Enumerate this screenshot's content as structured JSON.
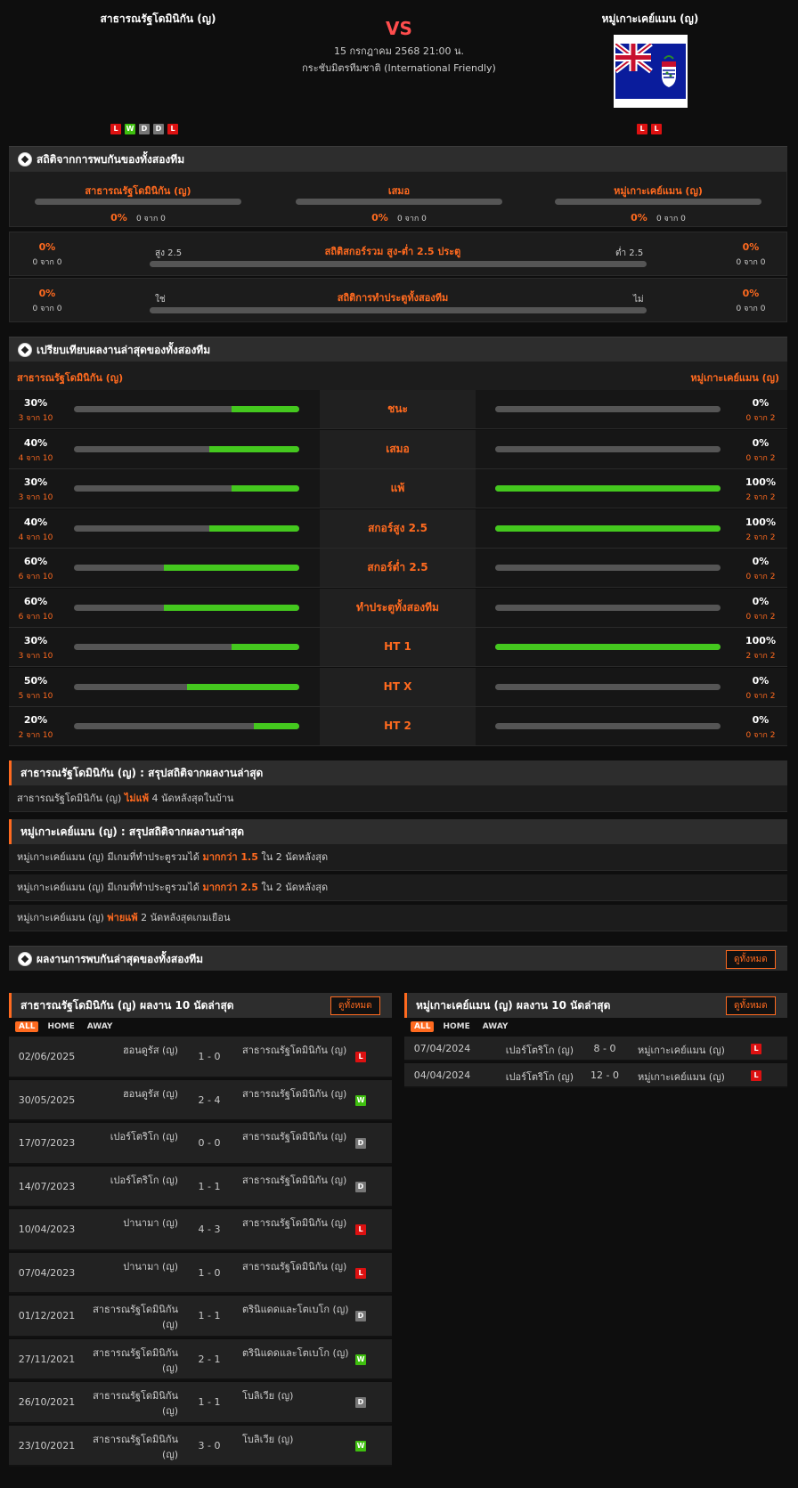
{
  "match": {
    "home": "สาธารณรัฐโดมินิกัน (ญ)",
    "away": "หมู่เกาะเคย์แมน (ญ)",
    "vs": "VS",
    "date": "15 กรกฎาคม 2568 21:00 น.",
    "competition": "กระชับมิตรทีมชาติ (International Friendly)",
    "home_form": [
      "L",
      "W",
      "D",
      "D",
      "L"
    ],
    "away_form": [
      "L",
      "L"
    ]
  },
  "h2h": {
    "title": "สถิติจากการพบกันของทั้งสองทีม",
    "cols": [
      {
        "name": "สาธารณรัฐโดมินิกัน (ญ)",
        "pct": "0%",
        "sub": "0 จาก 0"
      },
      {
        "name": "เสมอ",
        "pct": "0%",
        "sub": "0 จาก 0"
      },
      {
        "name": "หมู่เกาะเคย์แมน (ญ)",
        "pct": "0%",
        "sub": "0 จาก 0"
      }
    ],
    "ou": {
      "title": "สถิติสกอร์รวม สูง-ต่ำ 2.5 ประตู",
      "left_label": "สูง 2.5",
      "right_label": "ต่ำ 2.5",
      "left_pct": "0%",
      "left_sub": "0 จาก 0",
      "right_pct": "0%",
      "right_sub": "0 จาก 0"
    },
    "btts": {
      "title": "สถิติการทำประตูทั้งสองทีม",
      "left_label": "ใช่",
      "right_label": "ไม่",
      "left_pct": "0%",
      "left_sub": "0 จาก 0",
      "right_pct": "0%",
      "right_sub": "0 จาก 0"
    }
  },
  "compare": {
    "title": "เปรียบเทียบผลงานล่าสุดของทั้งสองทีม",
    "home": "สาธารณรัฐโดมินิกัน (ญ)",
    "away": "หมู่เกาะเคย์แมน (ญ)",
    "rows": [
      {
        "label": "ชนะ",
        "lp": "30%",
        "ls": "3 จาก 10",
        "lv": 0.3,
        "rp": "0%",
        "rs": "0 จาก 2",
        "rv": 0
      },
      {
        "label": "เสมอ",
        "lp": "40%",
        "ls": "4 จาก 10",
        "lv": 0.4,
        "rp": "0%",
        "rs": "0 จาก 2",
        "rv": 0
      },
      {
        "label": "แพ้",
        "lp": "30%",
        "ls": "3 จาก 10",
        "lv": 0.3,
        "rp": "100%",
        "rs": "2 จาก 2",
        "rv": 1
      },
      {
        "label": "สกอร์สูง 2.5",
        "lp": "40%",
        "ls": "4 จาก 10",
        "lv": 0.4,
        "rp": "100%",
        "rs": "2 จาก 2",
        "rv": 1
      },
      {
        "label": "สกอร์ต่ำ 2.5",
        "lp": "60%",
        "ls": "6 จาก 10",
        "lv": 0.6,
        "rp": "0%",
        "rs": "0 จาก 2",
        "rv": 0
      },
      {
        "label": "ทำประตูทั้งสองทีม",
        "lp": "60%",
        "ls": "6 จาก 10",
        "lv": 0.6,
        "rp": "0%",
        "rs": "0 จาก 2",
        "rv": 0
      },
      {
        "label": "HT 1",
        "lp": "30%",
        "ls": "3 จาก 10",
        "lv": 0.3,
        "rp": "100%",
        "rs": "2 จาก 2",
        "rv": 1
      },
      {
        "label": "HT X",
        "lp": "50%",
        "ls": "5 จาก 10",
        "lv": 0.5,
        "rp": "0%",
        "rs": "0 จาก 2",
        "rv": 0
      },
      {
        "label": "HT 2",
        "lp": "20%",
        "ls": "2 จาก 10",
        "lv": 0.2,
        "rp": "0%",
        "rs": "0 จาก 2",
        "rv": 0
      }
    ]
  },
  "summary_home": {
    "title": "สาธารณรัฐโดมินิกัน (ญ) : สรุปสถิติจากผลงานล่าสุด",
    "rows": [
      {
        "a": "สาธารณรัฐโดมินิกัน (ญ)",
        "hl": "ไม่แพ้",
        "b": "4  นัดหลังสุดในบ้าน"
      }
    ]
  },
  "summary_away": {
    "title": "หมู่เกาะเคย์แมน (ญ) : สรุปสถิติจากผลงานล่าสุด",
    "rows": [
      {
        "a": "หมู่เกาะเคย์แมน (ญ)  มีเกมที่ทำประตูรวมได้",
        "hl": "มากกว่า  1.5",
        "b": "ใน 2 นัดหลังสุด"
      },
      {
        "a": "หมู่เกาะเคย์แมน (ญ)  มีเกมที่ทำประตูรวมได้",
        "hl": "มากกว่า  2.5",
        "b": "ใน 2 นัดหลังสุด"
      },
      {
        "a": "หมู่เกาะเคย์แมน (ญ)",
        "hl": "พ่ายแพ้",
        "b": "2  นัดหลังสุดเกมเยือน"
      }
    ]
  },
  "recent_h2h": {
    "title": "ผลงานการพบกันล่าสุดของทั้งสองทีม",
    "button": "ดูทั้งหมด"
  },
  "home_last": {
    "title": "สาธารณรัฐโดมินิกัน (ญ) ผลงาน 10 นัดล่าสุด",
    "button": "ดูทั้งหมด",
    "filters": [
      "ALL",
      "HOME",
      "AWAY"
    ],
    "matches": [
      {
        "date": "02/06/2025",
        "home": "ฮอนดูรัส (ญ)",
        "score": "1 - 0",
        "away": "สาธารณรัฐโดมินิกัน (ญ)",
        "res": "L"
      },
      {
        "date": "30/05/2025",
        "home": "ฮอนดูรัส (ญ)",
        "score": "2 - 4",
        "away": "สาธารณรัฐโดมินิกัน (ญ)",
        "res": "W"
      },
      {
        "date": "17/07/2023",
        "home": "เปอร์โตริโก (ญ)",
        "score": "0 - 0",
        "away": "สาธารณรัฐโดมินิกัน (ญ)",
        "res": "D"
      },
      {
        "date": "14/07/2023",
        "home": "เปอร์โตริโก (ญ)",
        "score": "1 - 1",
        "away": "สาธารณรัฐโดมินิกัน (ญ)",
        "res": "D"
      },
      {
        "date": "10/04/2023",
        "home": "ปานามา (ญ)",
        "score": "4 - 3",
        "away": "สาธารณรัฐโดมินิกัน (ญ)",
        "res": "L"
      },
      {
        "date": "07/04/2023",
        "home": "ปานามา (ญ)",
        "score": "1 - 0",
        "away": "สาธารณรัฐโดมินิกัน (ญ)",
        "res": "L"
      },
      {
        "date": "01/12/2021",
        "home": "สาธารณรัฐโดมินิกัน (ญ)",
        "score": "1 - 1",
        "away": "ตรินิแดดและโตเบโก (ญ)",
        "res": "D"
      },
      {
        "date": "27/11/2021",
        "home": "สาธารณรัฐโดมินิกัน (ญ)",
        "score": "2 - 1",
        "away": "ตรินิแดดและโตเบโก (ญ)",
        "res": "W"
      },
      {
        "date": "26/10/2021",
        "home": "สาธารณรัฐโดมินิกัน (ญ)",
        "score": "1 - 1",
        "away": "โบลิเวีย (ญ)",
        "res": "D"
      },
      {
        "date": "23/10/2021",
        "home": "สาธารณรัฐโดมินิกัน (ญ)",
        "score": "3 - 0",
        "away": "โบลิเวีย (ญ)",
        "res": "W"
      }
    ]
  },
  "away_last": {
    "title": "หมู่เกาะเคย์แมน (ญ) ผลงาน 10 นัดล่าสุด",
    "button": "ดูทั้งหมด",
    "filters": [
      "ALL",
      "HOME",
      "AWAY"
    ],
    "matches": [
      {
        "date": "07/04/2024",
        "home": "เปอร์โตริโก (ญ)",
        "score": "8 - 0",
        "away": "หมู่เกาะเคย์แมน (ญ)",
        "res": "L"
      },
      {
        "date": "04/04/2024",
        "home": "เปอร์โตริโก (ญ)",
        "score": "12 - 0",
        "away": "หมู่เกาะเคย์แมน (ญ)",
        "res": "L"
      }
    ]
  }
}
